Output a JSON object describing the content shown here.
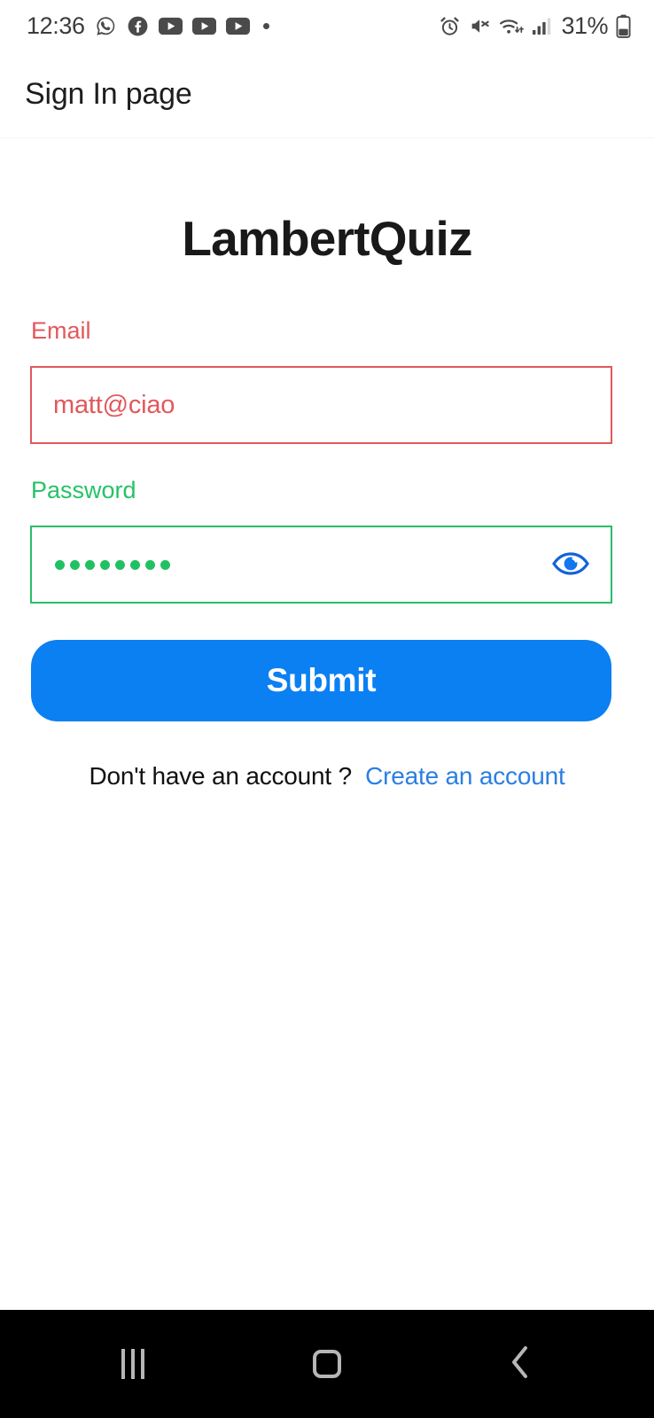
{
  "statusbar": {
    "time": "12:36",
    "battery_text": "31%",
    "left_icons": [
      {
        "name": "whatsapp-icon"
      },
      {
        "name": "facebook-icon"
      },
      {
        "name": "youtube-icon"
      },
      {
        "name": "youtube-icon"
      },
      {
        "name": "youtube-icon"
      },
      {
        "name": "notification-dot-icon"
      }
    ],
    "right_icons": [
      {
        "name": "alarm-clock-icon"
      },
      {
        "name": "volume-mute-icon"
      },
      {
        "name": "wifi-icon"
      },
      {
        "name": "cellular-signal-icon"
      },
      {
        "name": "battery-icon"
      }
    ],
    "icon_color": "#4a4a4a"
  },
  "titlebar": {
    "title": "Sign In page"
  },
  "main": {
    "brand": "LambertQuiz",
    "email_field": {
      "label": "Email",
      "value": "matt@ciao",
      "placeholder": "Email",
      "border_color": "#e2585c",
      "label_color": "#e2585c"
    },
    "password_field": {
      "label": "Password",
      "value": "••••••••",
      "masked_char_count": 8,
      "placeholder": "Password",
      "border_color": "#2bbd68",
      "label_color": "#25c366",
      "toggle_icon": "eye-icon",
      "toggle_icon_color": "#1463d6"
    },
    "submit": {
      "label": "Submit",
      "color": "#0b80f2"
    },
    "footer": {
      "text": "Don't have an account ?",
      "link": "Create an account",
      "link_color": "#2b7fe0"
    }
  },
  "navbar": {
    "buttons": [
      {
        "name": "recents-button",
        "icon": "recents-icon"
      },
      {
        "name": "home-button",
        "icon": "home-icon"
      },
      {
        "name": "back-button",
        "icon": "back-chevron-icon"
      }
    ],
    "icon_color": "#b6b6b6",
    "background": "#000000"
  }
}
